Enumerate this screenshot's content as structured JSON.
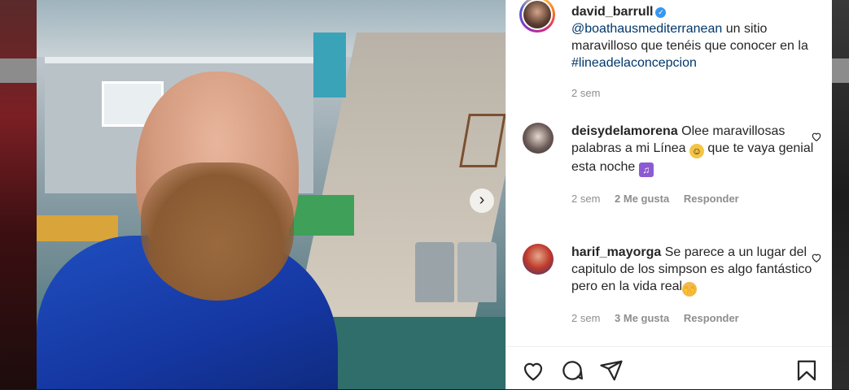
{
  "post": {
    "author": "david_barrull",
    "caption_mention": "@boathausmediterranean",
    "caption_text": " un sitio maravilloso que tenéis que conocer en la ",
    "caption_hashtag": "#lineadelaconcepcion",
    "time": "2 sem"
  },
  "comments": [
    {
      "user": "deisydelamorena",
      "text_a": " Olee maravillosas palabras a mi Línea ",
      "text_b": " que te vaya genial esta noche ",
      "time": "2 sem",
      "likes": "2 Me gusta",
      "reply": "Responder"
    },
    {
      "user": "harif_mayorga",
      "text_a": " Se parece a un lugar del capitulo de los simpson es algo fantástico pero en la vida real",
      "time": "2 sem",
      "likes": "3 Me gusta",
      "reply": "Responder"
    }
  ],
  "icons": [
    "verified-badge-icon",
    "heart-icon",
    "comment-icon",
    "share-icon",
    "bookmark-icon",
    "chevron-right-icon"
  ],
  "colors": {
    "accent": "#3897f0",
    "link": "#00376b",
    "muted": "#8e8e8e"
  }
}
